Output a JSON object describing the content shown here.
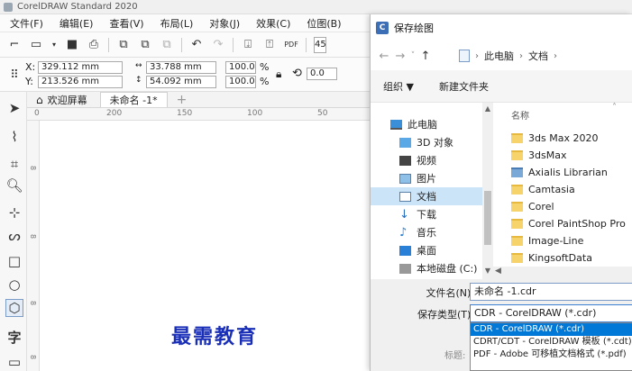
{
  "app": {
    "title": "CorelDRAW Standard 2020"
  },
  "menu": [
    "文件(F)",
    "编辑(E)",
    "查看(V)",
    "布局(L)",
    "对象(J)",
    "效果(C)",
    "位图(B)"
  ],
  "toolbar": {
    "zoom_fragment": "45"
  },
  "propbar": {
    "x_label": "X:",
    "y_label": "Y:",
    "x_value": "329.112 mm",
    "y_value": "213.526 mm",
    "width_value": "33.788 mm",
    "height_value": "54.092 mm",
    "scale_x": "100.0",
    "scale_y": "100.0",
    "percent": "%",
    "rotation": "0.0"
  },
  "tabs": {
    "welcome": "欢迎屏幕",
    "document": "未命名 -1*",
    "add": "+"
  },
  "ruler": {
    "h_ticks": [
      "0",
      "200",
      "150",
      "100",
      "50"
    ],
    "v_ticks": [
      "8",
      "8",
      "8",
      "8"
    ]
  },
  "dialog": {
    "title": "保存绘图",
    "breadcrumb": [
      "此电脑",
      "文档"
    ],
    "organize": "组织 ▼",
    "new_folder": "新建文件夹",
    "nav_items": [
      "此电脑",
      "3D 对象",
      "视频",
      "图片",
      "文档",
      "下载",
      "音乐",
      "桌面",
      "本地磁盘 (C:)"
    ],
    "column_name": "名称",
    "files": [
      "3ds Max 2020",
      "3dsMax",
      "Axialis Librarian",
      "Camtasia",
      "Corel",
      "Corel PaintShop Pro",
      "Image-Line",
      "KingsoftData"
    ],
    "filename_label": "文件名(N):",
    "filename_value": "未命名 -1.cdr",
    "filetype_label": "保存类型(T):",
    "filetype_value": "CDR - CorelDRAW (*.cdr)",
    "title_label": "标题:",
    "filetype_options": [
      "CDR - CorelDRAW (*.cdr)",
      "CDRT/CDT - CorelDRAW 模板 (*.cdt)",
      "PDF - Adobe 可移植文档格式 (*.pdf)"
    ]
  },
  "watermark": "最需教育"
}
